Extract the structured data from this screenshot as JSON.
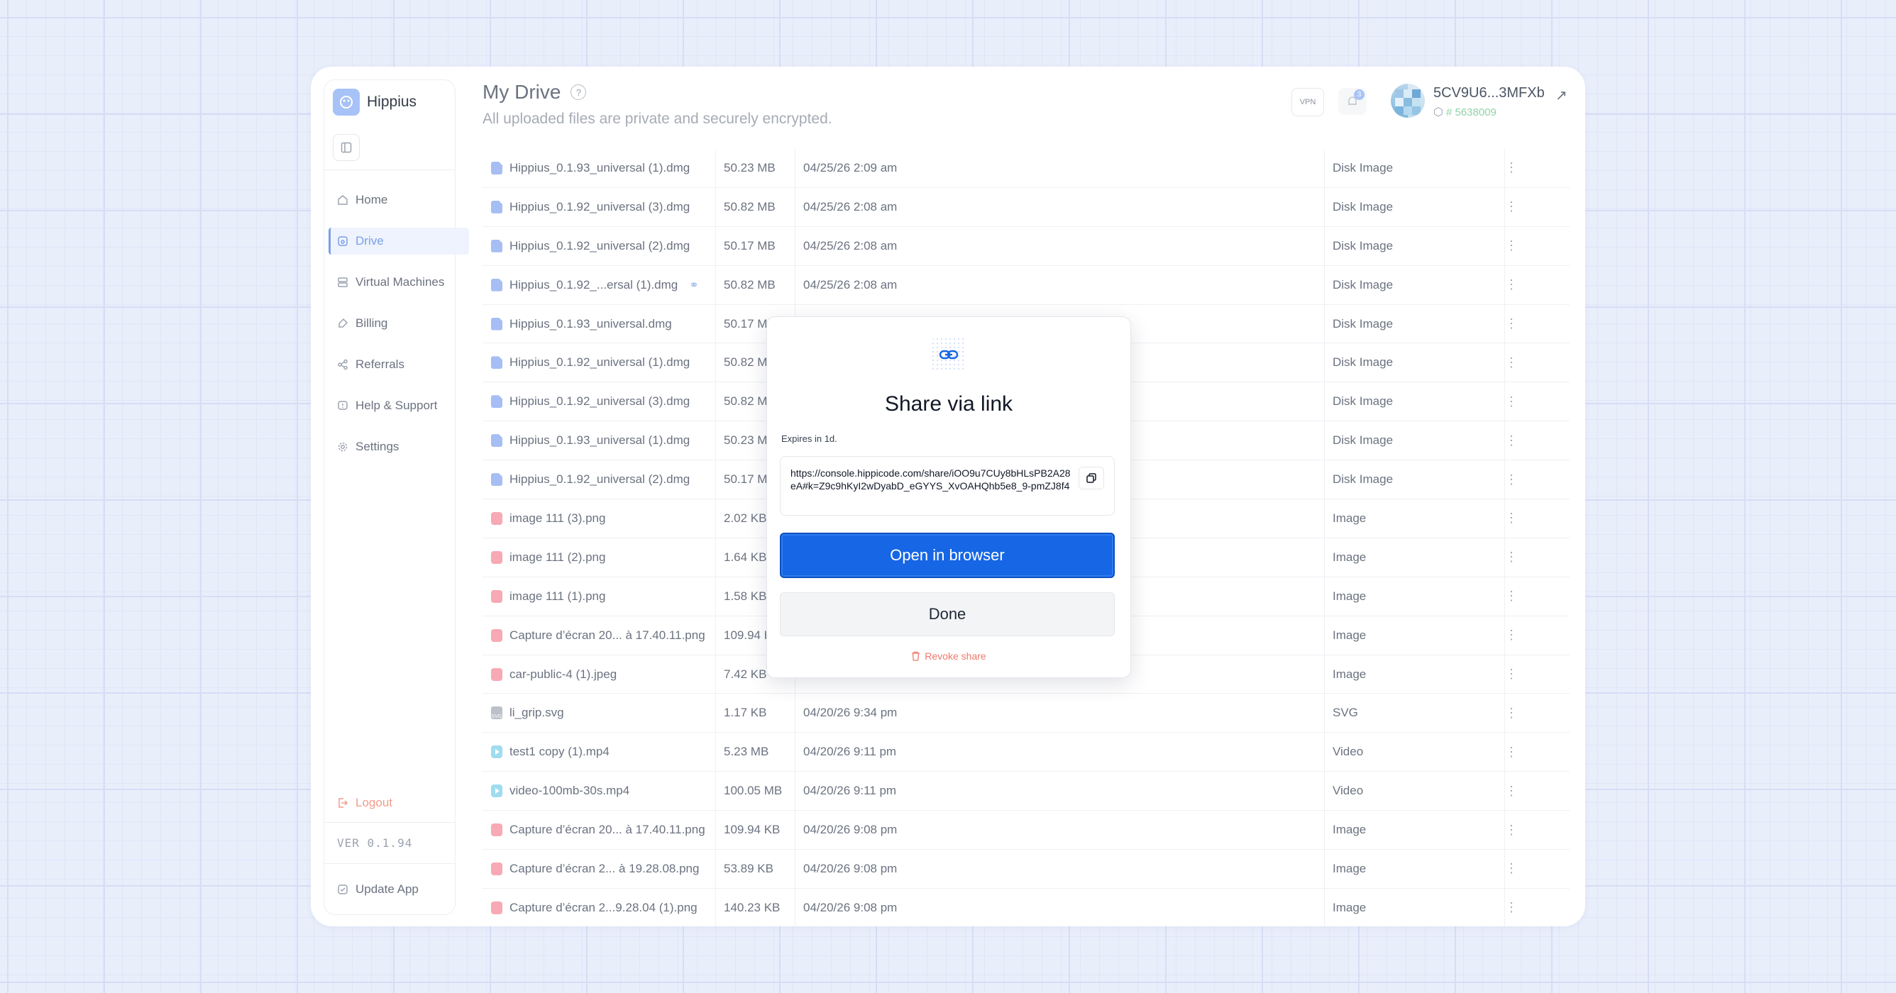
{
  "app": {
    "name": "Hippius",
    "version": "VER 0.1.94"
  },
  "header": {
    "title": "My Drive",
    "help_glyph": "?",
    "subtitle": "All uploaded files are private and securely encrypted.",
    "vpn_label": "VPN",
    "notifications_count": "3",
    "user_name": "5CV9U6...3MFXb",
    "user_id": "# 5638009"
  },
  "sidebar": {
    "items": [
      {
        "label": "Home",
        "icon": "home-icon"
      },
      {
        "label": "Drive",
        "icon": "drive-icon",
        "active": true
      },
      {
        "label": "Virtual Machines",
        "icon": "server-icon"
      },
      {
        "label": "Billing",
        "icon": "billing-icon"
      },
      {
        "label": "Referrals",
        "icon": "share-icon"
      },
      {
        "label": "Help & Support",
        "icon": "help-icon"
      },
      {
        "label": "Settings",
        "icon": "gear-icon"
      }
    ],
    "logout_label": "Logout",
    "update_label": "Update App"
  },
  "files": [
    {
      "name": "Hippius_0.1.93_universal (1).dmg",
      "size": "50.23 MB",
      "date": "04/25/26 2:09 am",
      "type": "Disk Image",
      "kind": "dmg"
    },
    {
      "name": "Hippius_0.1.92_universal (3).dmg",
      "size": "50.82 MB",
      "date": "04/25/26 2:08 am",
      "type": "Disk Image",
      "kind": "dmg"
    },
    {
      "name": "Hippius_0.1.92_universal (2).dmg",
      "size": "50.17 MB",
      "date": "04/25/26 2:08 am",
      "type": "Disk Image",
      "kind": "dmg"
    },
    {
      "name": "Hippius_0.1.92_...ersal (1).dmg",
      "size": "50.82 MB",
      "date": "04/25/26 2:08 am",
      "type": "Disk Image",
      "kind": "dmg",
      "shared": true
    },
    {
      "name": "Hippius_0.1.93_universal.dmg",
      "size": "50.17 M",
      "date": "",
      "type": "Disk Image",
      "kind": "dmg"
    },
    {
      "name": "Hippius_0.1.92_universal (1).dmg",
      "size": "50.82 M",
      "date": "",
      "type": "Disk Image",
      "kind": "dmg"
    },
    {
      "name": "Hippius_0.1.92_universal (3).dmg",
      "size": "50.82 M",
      "date": "",
      "type": "Disk Image",
      "kind": "dmg"
    },
    {
      "name": "Hippius_0.1.93_universal (1).dmg",
      "size": "50.23 M",
      "date": "",
      "type": "Disk Image",
      "kind": "dmg"
    },
    {
      "name": "Hippius_0.1.92_universal (2).dmg",
      "size": "50.17 M",
      "date": "",
      "type": "Disk Image",
      "kind": "dmg"
    },
    {
      "name": "image 111 (3).png",
      "size": "2.02 KB",
      "date": "",
      "type": "Image",
      "kind": "img"
    },
    {
      "name": "image 111 (2).png",
      "size": "1.64 KB",
      "date": "",
      "type": "Image",
      "kind": "img"
    },
    {
      "name": "image 111 (1).png",
      "size": "1.58 KB",
      "date": "",
      "type": "Image",
      "kind": "img"
    },
    {
      "name": "Capture d’écran 20... à 17.40.11.png",
      "size": "109.94 K",
      "date": "",
      "type": "Image",
      "kind": "img"
    },
    {
      "name": "car-public-4 (1).jpeg",
      "size": "7.42 KB",
      "date": "",
      "type": "Image",
      "kind": "img"
    },
    {
      "name": "li_grip.svg",
      "size": "1.17 KB",
      "date": "04/20/26 9:34 pm",
      "type": "SVG",
      "kind": "svg"
    },
    {
      "name": "test1 copy (1).mp4",
      "size": "5.23 MB",
      "date": "04/20/26 9:11 pm",
      "type": "Video",
      "kind": "vid"
    },
    {
      "name": "video-100mb-30s.mp4",
      "size": "100.05 MB",
      "date": "04/20/26 9:11 pm",
      "type": "Video",
      "kind": "vid"
    },
    {
      "name": "Capture d’écran 20... à 17.40.11.png",
      "size": "109.94 KB",
      "date": "04/20/26 9:08 pm",
      "type": "Image",
      "kind": "img"
    },
    {
      "name": "Capture d’écran 2... à 19.28.08.png",
      "size": "53.89 KB",
      "date": "04/20/26 9:08 pm",
      "type": "Image",
      "kind": "img"
    },
    {
      "name": "Capture d’écran 2...9.28.04 (1).png",
      "size": "140.23 KB",
      "date": "04/20/26 9:08 pm",
      "type": "Image",
      "kind": "img"
    }
  ],
  "modal": {
    "title": "Share via link",
    "expires": "Expires in 1d.",
    "url": "https://console.hippicode.com/share/iOO9u7CUy8bHLsPB2A28eA#k=Z9c9hKyI2wDyabD_eGYYS_XvOAHQhb5e8_9-pmZJ8f4",
    "open_label": "Open in browser",
    "done_label": "Done",
    "revoke_label": "Revoke share"
  },
  "colors": {
    "primary": "#1666e5",
    "accent": "#7b9fe6",
    "danger": "#f0796a",
    "success": "#8fd3a6"
  }
}
